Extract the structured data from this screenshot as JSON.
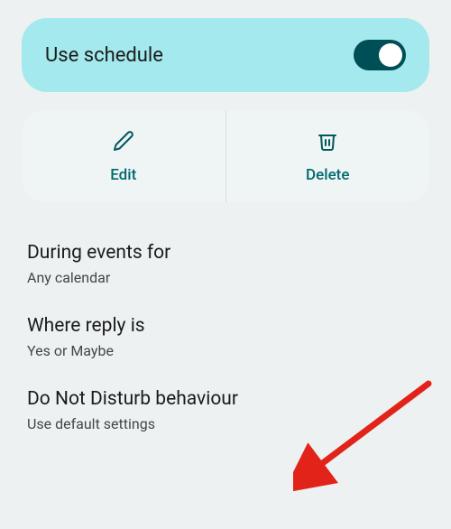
{
  "toggle": {
    "label": "Use schedule",
    "enabled": true
  },
  "actions": {
    "edit": "Edit",
    "delete": "Delete"
  },
  "settings": [
    {
      "title": "During events for",
      "subtitle": "Any calendar"
    },
    {
      "title": "Where reply is",
      "subtitle": "Yes or Maybe"
    },
    {
      "title": "Do Not Disturb behaviour",
      "subtitle": "Use default settings"
    }
  ],
  "colors": {
    "accent": "#00696f",
    "toggleTrack": "#004f57",
    "toggleCard": "#a4e9ed",
    "arrow": "#e2231a"
  }
}
